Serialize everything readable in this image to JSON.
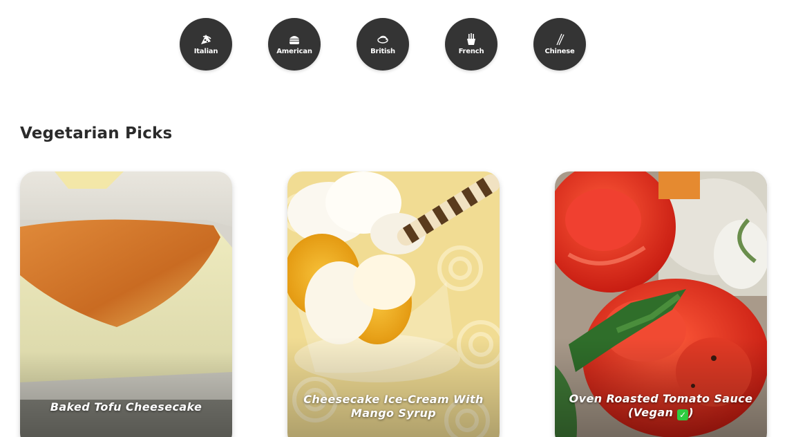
{
  "cuisines": [
    {
      "label": "Italian",
      "icon": "pizza-icon"
    },
    {
      "label": "American",
      "icon": "burger-icon"
    },
    {
      "label": "British",
      "icon": "pie-icon"
    },
    {
      "label": "French",
      "icon": "fries-icon"
    },
    {
      "label": "Chinese",
      "icon": "chopsticks-icon"
    }
  ],
  "section": {
    "title": "Vegetarian Picks"
  },
  "cards": [
    {
      "title": "Baked Tofu Cheesecake"
    },
    {
      "title": "Cheesecake Ice-Cream With Mango Syrup"
    },
    {
      "title_main": "Oven Roasted Tomato Sauce (Vegan ",
      "badge": "✓",
      "title_tail": ")"
    }
  ],
  "colors": {
    "circle": "#343434",
    "heading": "#2b2b2b",
    "vegan_badge": "#2ecc40"
  }
}
